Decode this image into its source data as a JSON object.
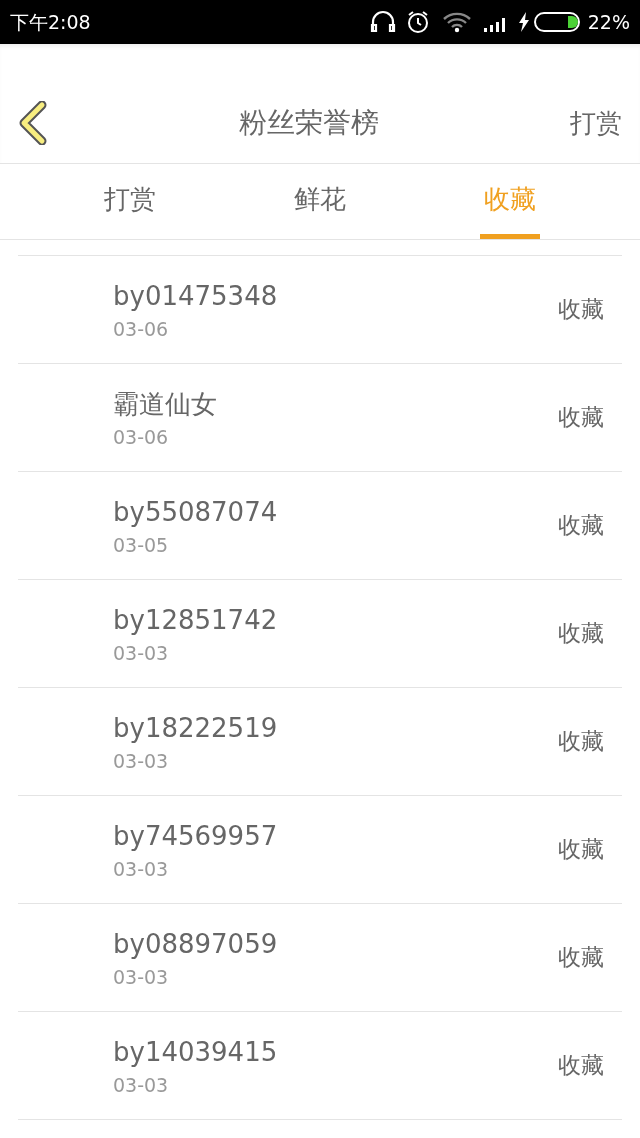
{
  "status_bar": {
    "time": "下午2:08",
    "battery": "22%"
  },
  "header": {
    "title": "粉丝荣誉榜",
    "action": "打赏"
  },
  "tabs": [
    {
      "label": "打赏",
      "selected": false
    },
    {
      "label": "鲜花",
      "selected": false
    },
    {
      "label": "收藏",
      "selected": true
    }
  ],
  "rows": [
    {
      "name": "by01475348",
      "date": "03-06",
      "type": "收藏"
    },
    {
      "name": "霸道仙女",
      "date": "03-06",
      "type": "收藏"
    },
    {
      "name": "by55087074",
      "date": "03-05",
      "type": "收藏"
    },
    {
      "name": "by12851742",
      "date": "03-03",
      "type": "收藏"
    },
    {
      "name": "by18222519",
      "date": "03-03",
      "type": "收藏"
    },
    {
      "name": "by74569957",
      "date": "03-03",
      "type": "收藏"
    },
    {
      "name": "by08897059",
      "date": "03-03",
      "type": "收藏"
    },
    {
      "name": "by14039415",
      "date": "03-03",
      "type": "收藏"
    }
  ]
}
